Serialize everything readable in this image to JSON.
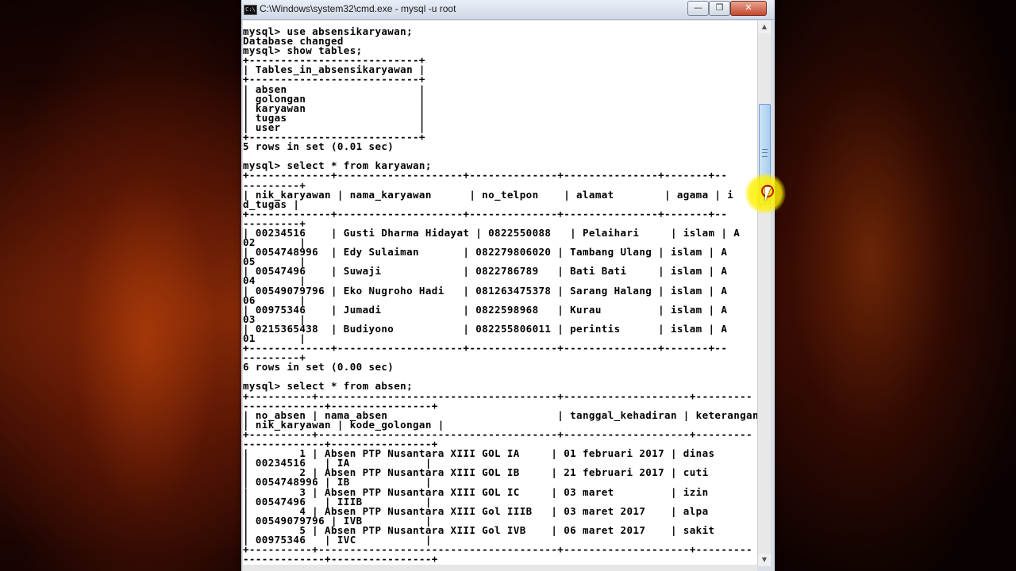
{
  "window": {
    "title": "C:\\Windows\\system32\\cmd.exe - mysql  -u root",
    "icon_label": "C:\\",
    "buttons": {
      "minimize": "—",
      "maximize": "❐",
      "close": "✕"
    }
  },
  "console": {
    "text": "mysql> use absensikaryawan;\nDatabase changed\nmysql> show tables;\n+---------------------------+\n| Tables_in_absensikaryawan |\n+---------------------------+\n| absen                     |\n| golongan                  |\n| karyawan                  |\n| tugas                     |\n| user                      |\n+---------------------------+\n5 rows in set (0.01 sec)\n\nmysql> select * from karyawan;\n+-------------+--------------------+--------------+---------------+-------+--\n---------+\n| nik_karyawan | nama_karyawan      | no_telpon    | alamat        | agama | i\nd_tugas |\n+-------------+--------------------+--------------+---------------+-------+--\n---------+\n| 00234516    | Gusti Dharma Hidayat | 0822550088   | Pelaihari     | islam | A\n02       |\n| 0054748996  | Edy Sulaiman       | 082279806020 | Tambang Ulang | islam | A\n05       |\n| 00547496    | Suwaji             | 0822786789   | Bati Bati     | islam | A\n04       |\n| 00549079796 | Eko Nugroho Hadi   | 081263475378 | Sarang Halang | islam | A\n06       |\n| 00975346    | Jumadi             | 0822598968   | Kurau         | islam | A\n03       |\n| 0215365438  | Budiyono           | 082255806011 | perintis      | islam | A\n01       |\n+-------------+--------------------+--------------+---------------+-------+--\n---------+\n6 rows in set (0.00 sec)\n\nmysql> select * from absen;\n+----------+--------------------------------------+--------------------+---------\n-------------+----------------+\n| no_absen | nama_absen                           | tanggal_kehadiran | keterangan\n| nik_karyawan | kode_golongan |\n+----------+--------------------------------------+--------------------+---------\n-------------+----------------+\n|        1 | Absen PTP Nusantara XIII GOL IA     | 01 februari 2017 | dinas\n| 00234516   | IA            |\n|        2 | Absen PTP Nusantara XIII GOL IB     | 21 februari 2017 | cuti\n| 0054748996 | IB            |\n|        3 | Absen PTP Nusantara XIII GOL IC     | 03 maret         | izin\n| 00547496   | IIIB          |\n|        4 | Absen PTP Nusantara XIII Gol IIIB   | 03 maret 2017    | alpa\n| 00549079796 | IVB          |\n|        5 | Absen PTP Nusantara XIII Gol IVB    | 06 maret 2017    | sakit\n| 00975346   | IVC           |\n+----------+--------------------------------------+--------------------+---------\n-------------+----------------+"
  },
  "scrollbar": {
    "up_arrow": "▲",
    "down_arrow": "▼"
  }
}
